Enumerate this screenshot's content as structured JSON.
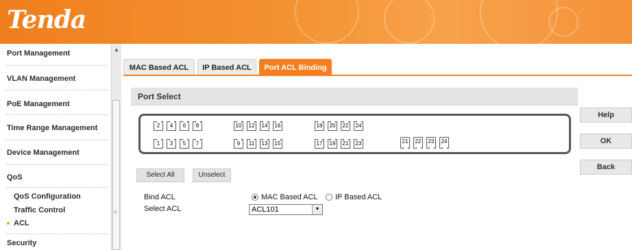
{
  "brand": {
    "logo_text": "Tenda",
    "accent": "#f57f20"
  },
  "sidebar": {
    "items": [
      {
        "label": "Port Management"
      },
      {
        "label": "VLAN Management"
      },
      {
        "label": "PoE Management"
      },
      {
        "label": "Time Range Management"
      },
      {
        "label": "Device Management"
      },
      {
        "label": "QoS"
      },
      {
        "label": "Security"
      }
    ],
    "sub_items": [
      {
        "label": "QoS Configuration"
      },
      {
        "label": "Traffic Control"
      },
      {
        "label": "ACL"
      }
    ]
  },
  "tabs": [
    {
      "label": "MAC Based ACL"
    },
    {
      "label": "IP Based ACL"
    },
    {
      "label": "Port ACL Binding"
    }
  ],
  "port_select": {
    "title": "Port Select",
    "top_row": [
      "2",
      "4",
      "6",
      "8",
      "10",
      "12",
      "14",
      "16",
      "18",
      "20",
      "22",
      "24"
    ],
    "bottom_row": [
      "1",
      "3",
      "5",
      "7",
      "9",
      "11",
      "13",
      "15",
      "17",
      "19",
      "21",
      "23"
    ],
    "sfp_ports": [
      "21",
      "22",
      "23",
      "24"
    ]
  },
  "buttons": {
    "help": "Help",
    "ok": "OK",
    "back": "Back",
    "select_all": "Select All",
    "unselect": "Unselect"
  },
  "form": {
    "bind_acl_label": "Bind ACL",
    "bind_options": [
      "MAC Based ACL",
      "IP Based ACL"
    ],
    "bind_selected": "MAC Based ACL",
    "select_acl_label": "Select ACL",
    "select_acl_value": "ACL101"
  }
}
